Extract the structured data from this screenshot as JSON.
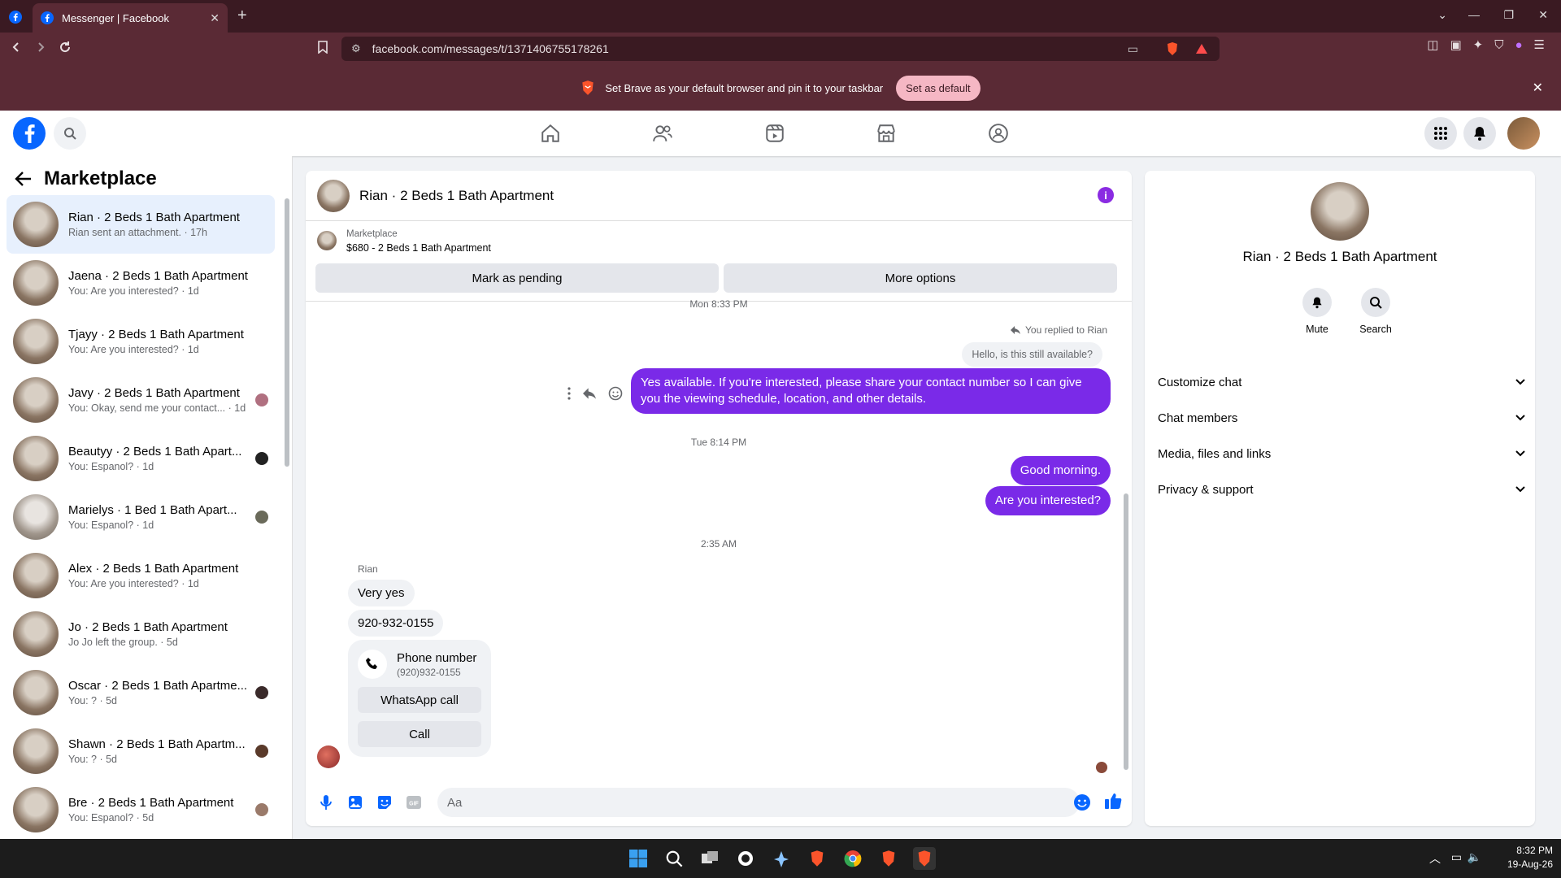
{
  "browser": {
    "tab_title": "Messenger | Facebook",
    "url": "facebook.com/messages/t/1371406755178261",
    "banner_text": "Set Brave as your default browser and pin it to your taskbar",
    "banner_button": "Set as default"
  },
  "sidebar": {
    "title": "Marketplace",
    "conversations": [
      {
        "name": "Rian · 2 Beds 1 Bath Apartment",
        "preview": "Rian sent an attachment. · 17h"
      },
      {
        "name": "Jaena · 2 Beds 1 Bath Apartment",
        "preview": "You: Are you interested? · 1d"
      },
      {
        "name": "Tjayy · 2 Beds 1 Bath Apartment",
        "preview": "You: Are you interested? · 1d"
      },
      {
        "name": "Javy · 2 Beds 1 Bath Apartment",
        "preview": "You: Okay, send me your contact... · 1d"
      },
      {
        "name": "Beautyy · 2 Beds 1 Bath Apart...",
        "preview": "You: Espanol? · 1d"
      },
      {
        "name": "Marielys · 1 Bed 1 Bath Apart...",
        "preview": "You: Espanol? · 1d"
      },
      {
        "name": "Alex · 2 Beds 1 Bath Apartment",
        "preview": "You: Are you interested? · 1d"
      },
      {
        "name": "Jo · 2 Beds 1 Bath Apartment",
        "preview": "Jo Jo left the group. · 5d"
      },
      {
        "name": "Oscar · 2 Beds 1 Bath Apartme...",
        "preview": "You: ? · 5d"
      },
      {
        "name": "Shawn · 2 Beds 1 Bath Apartm...",
        "preview": "You: ? · 5d"
      },
      {
        "name": "Bre · 2 Beds 1 Bath Apartment",
        "preview": "You: Espanol? · 5d"
      }
    ]
  },
  "chat": {
    "title": "Rian · 2 Beds 1 Bath Apartment",
    "marketplace_label": "Marketplace",
    "listing": "$680 - 2 Beds 1 Bath Apartment",
    "btn_pending": "Mark as pending",
    "btn_more": "More options",
    "time_top": "Mon 8:33 PM",
    "reply_note": "You replied to Rian",
    "quoted": "Hello, is this still available?",
    "msg_out_1": "Yes available. If you're interested, please share your contact number so I can give you the viewing schedule, location, and other details.",
    "time_2": "Tue 8:14 PM",
    "msg_out_2": "Good morning.",
    "msg_out_3": "Are you interested?",
    "time_3": "2:35 AM",
    "sender": "Rian",
    "msg_in_1": "Very yes",
    "msg_in_2": "920-932-0155",
    "card_title": "Phone number",
    "card_number": "(920)932-0155",
    "card_btn_whatsapp": "WhatsApp call",
    "card_btn_call": "Call",
    "composer_placeholder": "Aa"
  },
  "info": {
    "name": "Rian · 2 Beds 1 Bath Apartment",
    "mute": "Mute",
    "search": "Search",
    "rows": [
      "Customize chat",
      "Chat members",
      "Media, files and links",
      "Privacy & support"
    ]
  },
  "taskbar": {
    "time": "8:32 PM",
    "date": "19-Aug-26"
  },
  "colors": {
    "fb_blue": "#0866ff",
    "accent_purple": "#7a2ae8",
    "brave_chrome": "#5a2a35"
  }
}
